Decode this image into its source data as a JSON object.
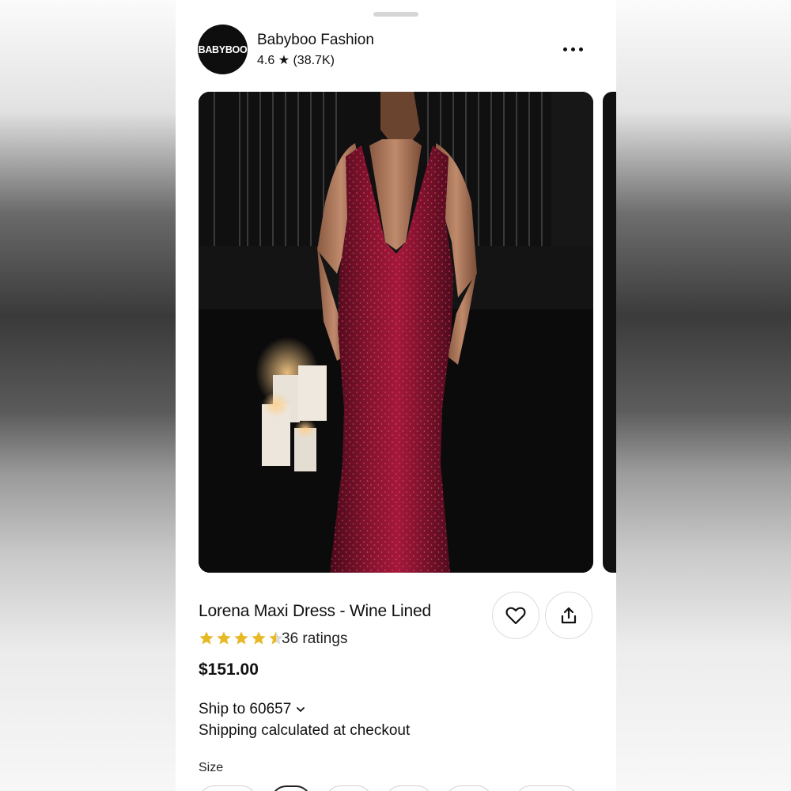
{
  "shop": {
    "logo_text": "BABYBOO",
    "name": "Babyboo Fashion",
    "rating_text": "4.6 ★ (38.7K)"
  },
  "product": {
    "title": "Lorena Maxi Dress - Wine Lined",
    "rating_value": 4.5,
    "ratings_label": "36 ratings",
    "price": "$151.00"
  },
  "shipping": {
    "ship_to": "Ship to 60657",
    "note": "Shipping calculated at checkout"
  },
  "size": {
    "label": "Size"
  },
  "colors": {
    "star": "#e8b923",
    "dress": "#8a1430"
  }
}
